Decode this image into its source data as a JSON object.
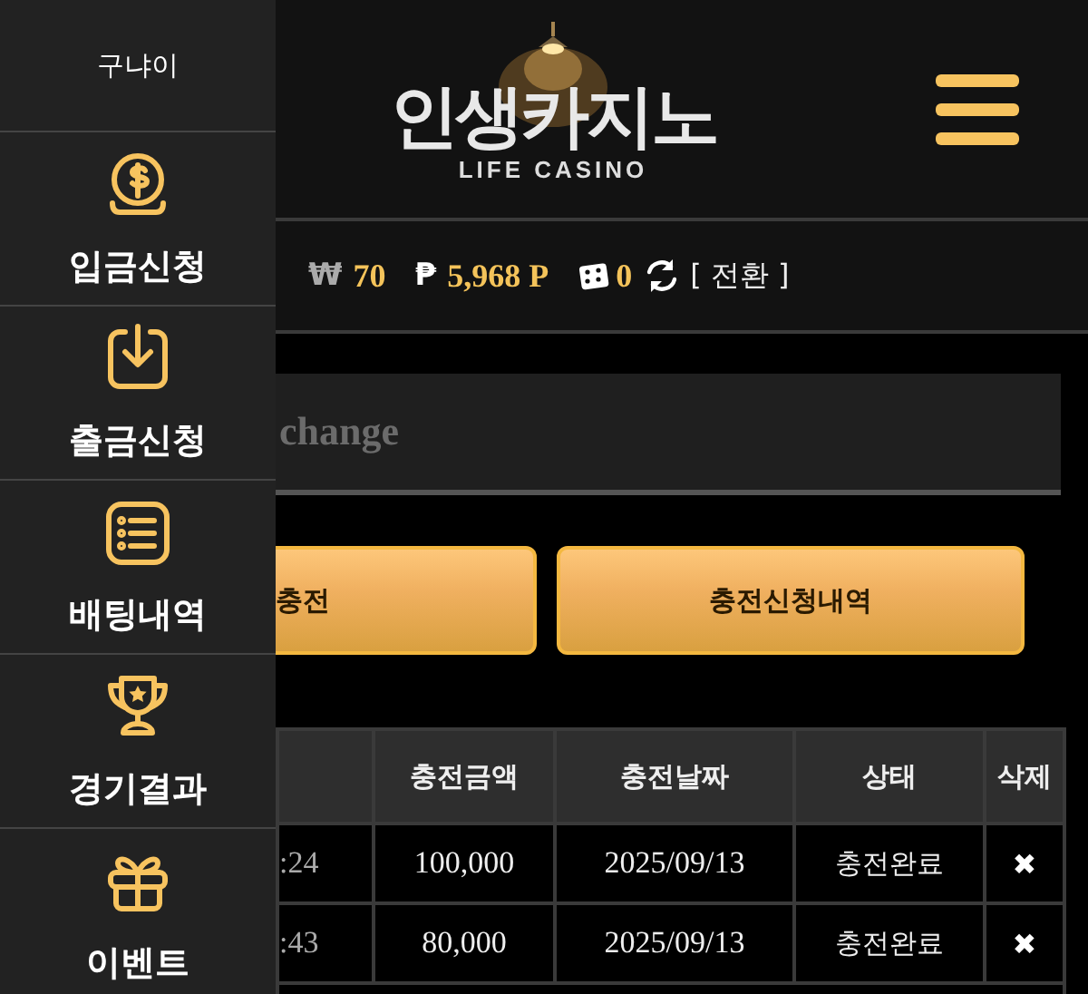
{
  "sidebar": {
    "user": "구냐이",
    "items": [
      {
        "label": "입금신청",
        "kind": "coin"
      },
      {
        "label": "출금신청",
        "kind": "download"
      },
      {
        "label": "배팅내역",
        "kind": "list"
      },
      {
        "label": "경기결과",
        "kind": "trophy"
      },
      {
        "label": "이벤트",
        "kind": "gift"
      }
    ]
  },
  "header": {
    "logo_title": "인생카지노",
    "logo_subtitle": "LIFE CASINO"
  },
  "balance": {
    "cash_symbol": "₩",
    "cash": "70",
    "point_symbol": "₱",
    "points": "5,968 P",
    "chips": "0",
    "convert": "[ 전환 ]"
  },
  "panel_title": "change",
  "buttons": [
    "충전",
    "충전신청내역"
  ],
  "table": {
    "columns": [
      "충전금액",
      "충전날짜",
      "상태",
      "삭제"
    ],
    "rows": [
      {
        "column_1": ":24",
        "amount": "100,000",
        "date": "2025/09/13",
        "status": "충전완료",
        "delete": "✖"
      },
      {
        "column_1": ":43",
        "amount": "80,000",
        "date": "2025/09/13",
        "status": "충전완료",
        "delete": "✖"
      }
    ]
  }
}
